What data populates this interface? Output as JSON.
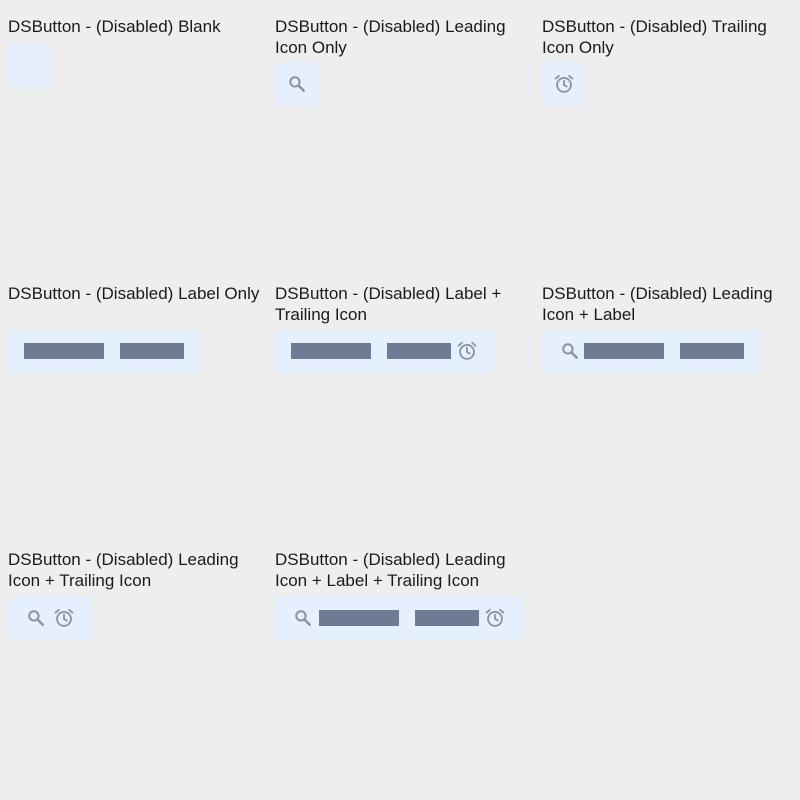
{
  "variants": [
    {
      "title": "DSButton - (Disabled) Blank"
    },
    {
      "title": "DSButton - (Disabled) Leading Icon Only"
    },
    {
      "title": "DSButton - (Disabled) Trailing Icon Only"
    },
    {
      "title": "DSButton - (Disabled) Label Only"
    },
    {
      "title": "DSButton - (Disabled) Label + Trailing Icon"
    },
    {
      "title": "DSButton - (Disabled) Leading Icon + Label"
    },
    {
      "title": "DSButton - (Disabled) Leading Icon + Trailing Icon"
    },
    {
      "title": "DSButton - (Disabled) Leading Icon + Label + Trailing Icon"
    }
  ],
  "icons": {
    "leading": "search-icon",
    "trailing": "alarm-icon"
  },
  "colors": {
    "page_background": "#eeeeee",
    "button_background_disabled": "#e6effd",
    "icon_disabled": "#8a93a3",
    "label_placeholder": "#6e7b93",
    "title_text": "#1a1a1a"
  }
}
